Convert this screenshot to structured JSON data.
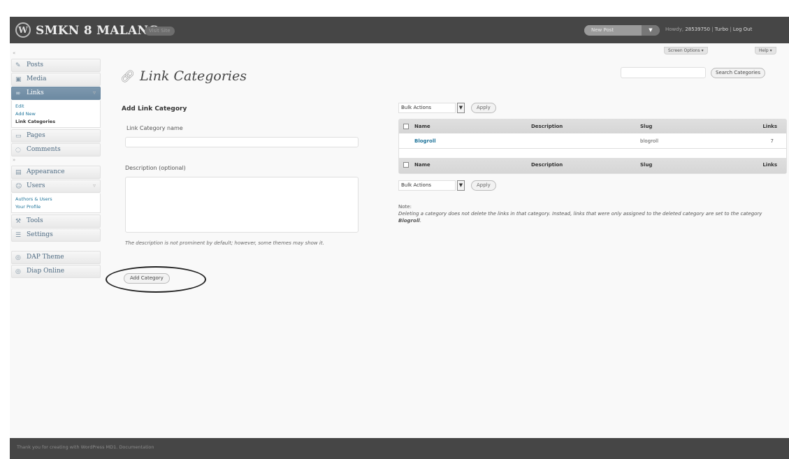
{
  "header": {
    "site_title": "SMKN 8 MALANG",
    "visit_site": "Visit Site",
    "favorite_action": "New Post",
    "favorite_toggle": "▼",
    "howdy": "Howdy,",
    "username": "28539750",
    "turbo": "Turbo",
    "log_out": "Log Out"
  },
  "screen_meta": {
    "screen_options": "Screen Options ▾",
    "help": "Help ▾"
  },
  "sidebar": {
    "items": [
      {
        "label": "Posts",
        "icon": "pin-icon"
      },
      {
        "label": "Media",
        "icon": "media-icon"
      },
      {
        "label": "Links",
        "icon": "link-icon",
        "submenu": [
          "Edit",
          "Add New",
          "Link Categories"
        ]
      },
      {
        "label": "Pages",
        "icon": "page-icon"
      },
      {
        "label": "Comments",
        "icon": "comment-icon"
      },
      {
        "label": "Appearance",
        "icon": "appearance-icon"
      },
      {
        "label": "Users",
        "icon": "users-icon",
        "submenu": [
          "Authors & Users",
          "Your Profile"
        ]
      },
      {
        "label": "Tools",
        "icon": "tools-icon"
      },
      {
        "label": "Settings",
        "icon": "settings-icon"
      },
      {
        "label": "DAP Theme",
        "icon": "theme-icon"
      },
      {
        "label": "Diap Online",
        "icon": "online-icon"
      }
    ]
  },
  "page": {
    "title": "Link Categories"
  },
  "search": {
    "value": "",
    "button": "Search Categories"
  },
  "form": {
    "title": "Add Link Category",
    "name_label": "Link Category name",
    "name_value": "",
    "description_label": "Description (optional)",
    "description_value": "",
    "description_help": "The description is not prominent by default; however, some themes may show it.",
    "submit": "Add Category"
  },
  "bulk": {
    "label": "Bulk Actions",
    "arrow": "▼",
    "apply": "Apply"
  },
  "table": {
    "columns": [
      "Name",
      "Description",
      "Slug",
      "Links"
    ],
    "rows": [
      {
        "name": "Blogroll",
        "description": "",
        "slug": "blogroll",
        "links": "7"
      }
    ]
  },
  "note": {
    "heading": "Note:",
    "body": "Deleting a category does not delete the links in that category. Instead, links that were only assigned to the deleted category are set to the category",
    "strong": "Blogroll",
    "end": "."
  },
  "footer": {
    "text": "Thank you for creating with WordPress MD1. Documentation"
  }
}
